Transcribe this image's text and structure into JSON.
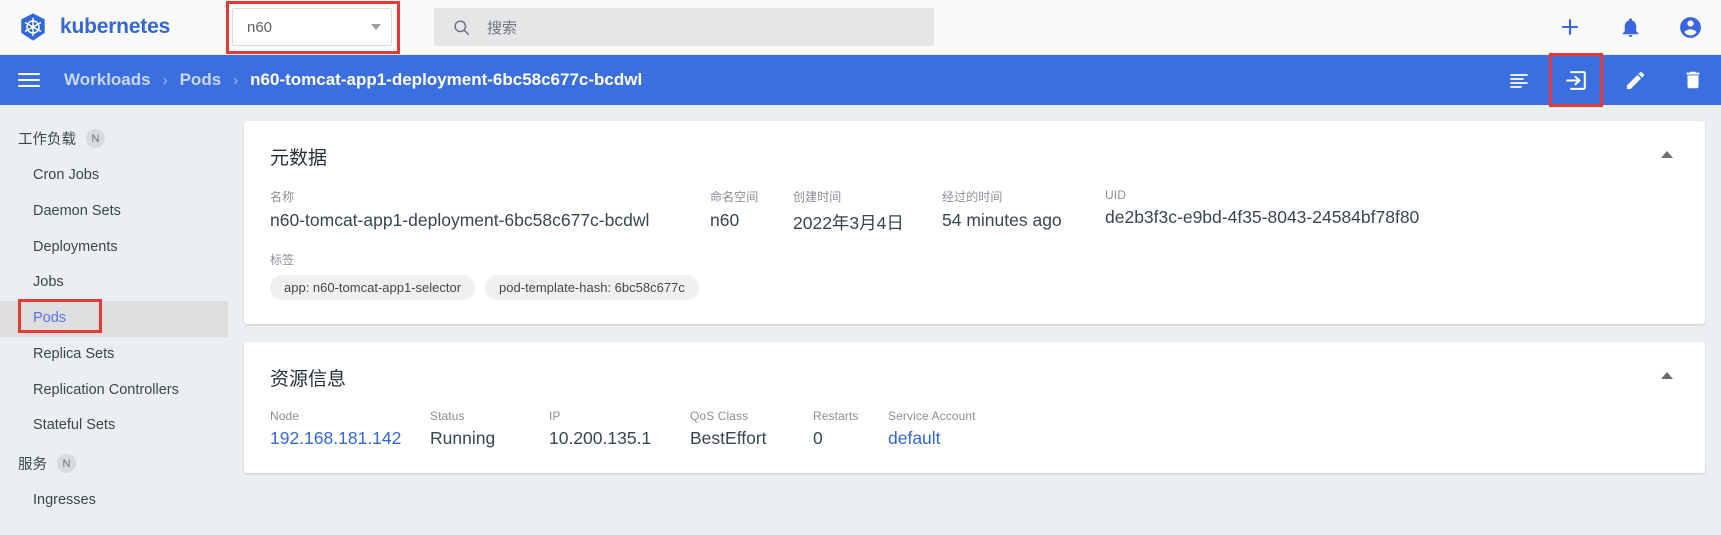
{
  "topbar": {
    "brand": "kubernetes",
    "brand_color": "#3367d6",
    "namespace_selector": {
      "value": "n60",
      "icon": "chevron-down-icon",
      "highlighted": true
    },
    "search": {
      "placeholder": "搜索",
      "value": "",
      "icon": "search-icon"
    },
    "actions": [
      {
        "name": "add-icon",
        "glyph": "+"
      },
      {
        "name": "notifications-bell-icon",
        "glyph": "bell"
      },
      {
        "name": "account-circle-icon",
        "glyph": "account"
      }
    ]
  },
  "breadcrumb_bar": {
    "menu_icon": "hamburger-menu-icon",
    "crumbs": [
      {
        "label": "Workloads",
        "current": false
      },
      {
        "label": "Pods",
        "current": false
      },
      {
        "label": "n60-tomcat-app1-deployment-6bc58c677c-bcdwl",
        "current": true
      }
    ],
    "separator": "›",
    "bar_color": "#3b6fe0",
    "actions": [
      {
        "name": "logs-icon",
        "label": "Logs"
      },
      {
        "name": "exec-terminal-icon",
        "label": "Exec",
        "highlighted": true
      },
      {
        "name": "edit-pencil-icon",
        "label": "Edit"
      },
      {
        "name": "delete-trash-icon",
        "label": "Delete"
      }
    ]
  },
  "sidebar": {
    "groups": [
      {
        "label": "工作负载",
        "badge": "N",
        "items": [
          {
            "label": "Cron Jobs",
            "selected": false
          },
          {
            "label": "Daemon Sets",
            "selected": false
          },
          {
            "label": "Deployments",
            "selected": false
          },
          {
            "label": "Jobs",
            "selected": false
          },
          {
            "label": "Pods",
            "selected": true,
            "highlighted": true
          },
          {
            "label": "Replica Sets",
            "selected": false
          },
          {
            "label": "Replication Controllers",
            "selected": false
          },
          {
            "label": "Stateful Sets",
            "selected": false
          }
        ]
      },
      {
        "label": "服务",
        "badge": "N",
        "items": [
          {
            "label": "Ingresses",
            "selected": false
          }
        ]
      }
    ]
  },
  "metadata_card": {
    "title": "元数据",
    "collapse_icon": "chevron-up-icon",
    "fields": [
      {
        "label": "名称",
        "value": "n60-tomcat-app1-deployment-6bc58c677c-bcdwl"
      },
      {
        "label": "命名空间",
        "value": "n60"
      },
      {
        "label": "创建时间",
        "value": "2022年3月4日"
      },
      {
        "label": "经过的时间",
        "value": "54 minutes ago"
      },
      {
        "label": "UID",
        "value": "de2b3f3c-e9bd-4f35-8043-24584bf78f80"
      }
    ],
    "labels_title": "标签",
    "labels": [
      "app: n60-tomcat-app1-selector",
      "pod-template-hash: 6bc58c677c"
    ]
  },
  "resource_card": {
    "title": "资源信息",
    "collapse_icon": "chevron-up-icon",
    "fields": [
      {
        "label": "Node",
        "value": "192.168.181.142",
        "link": true
      },
      {
        "label": "Status",
        "value": "Running",
        "link": false
      },
      {
        "label": "IP",
        "value": "10.200.135.1",
        "link": false
      },
      {
        "label": "QoS Class",
        "value": "BestEffort",
        "link": false
      },
      {
        "label": "Restarts",
        "value": "0",
        "link": false
      },
      {
        "label": "Service Account",
        "value": "default",
        "link": true
      }
    ]
  }
}
